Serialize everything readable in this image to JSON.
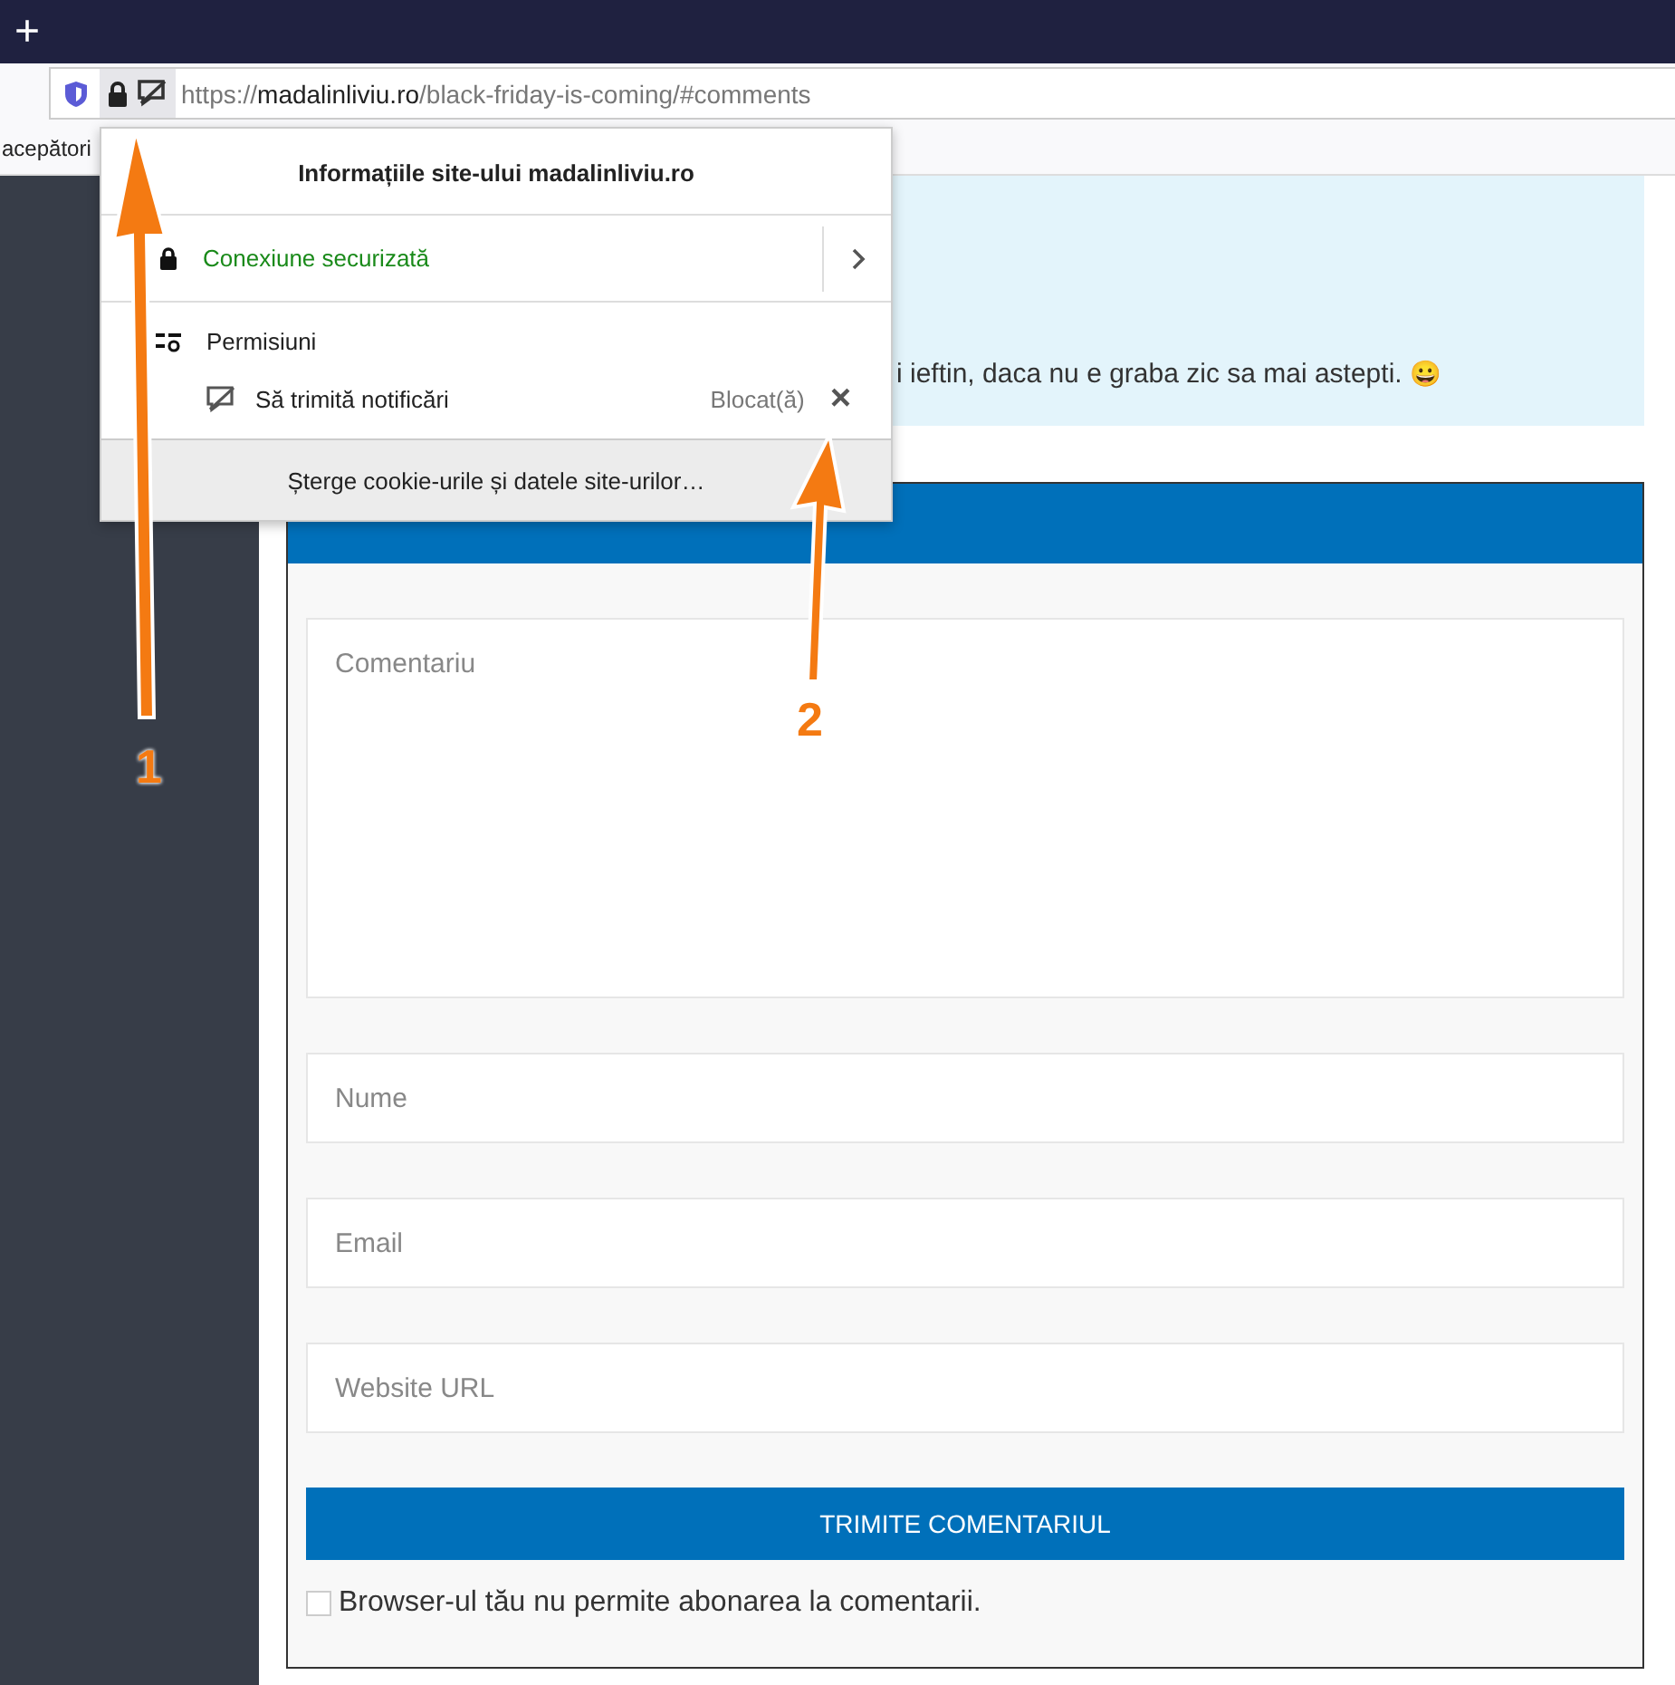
{
  "tab_bar": {
    "new_tab": "+"
  },
  "address_bar": {
    "url_scheme": "https://",
    "url_domain": "madalinliviu.ro",
    "url_path": "/black-friday-is-coming/#comments",
    "notifications_blocked": true
  },
  "bookmarks_bar": {
    "items": [
      "acepători"
    ]
  },
  "comment": {
    "text": "i ieftin, daca nu e graba zic sa mai astepti.",
    "emoji": "😀"
  },
  "reply_form": {
    "fields": [
      {
        "kind": "textarea",
        "placeholder": "Comentariu"
      },
      {
        "kind": "input",
        "placeholder": "Nume"
      },
      {
        "kind": "input",
        "placeholder": "Email"
      },
      {
        "kind": "input",
        "placeholder": "Website URL"
      }
    ],
    "submit": "TRIMITE COMENTARIUL",
    "subscribe": {
      "label": "Browser-ul tău nu permite abonarea la comentarii.",
      "checked": false
    }
  },
  "site_info_popup": {
    "title": "Informațiile site-ului madalinliviu.ro",
    "connection": "Conexiune securizată",
    "permissions_heading": "Permisiuni",
    "permissions": [
      {
        "label": "Să trimită notificări",
        "status": "Blocat(ă)",
        "clear": "×"
      }
    ],
    "clear_button": "Șterge cookie-urile și datele site-urilor…"
  },
  "annotations": [
    {
      "label": "1"
    },
    {
      "label": "2"
    }
  ]
}
